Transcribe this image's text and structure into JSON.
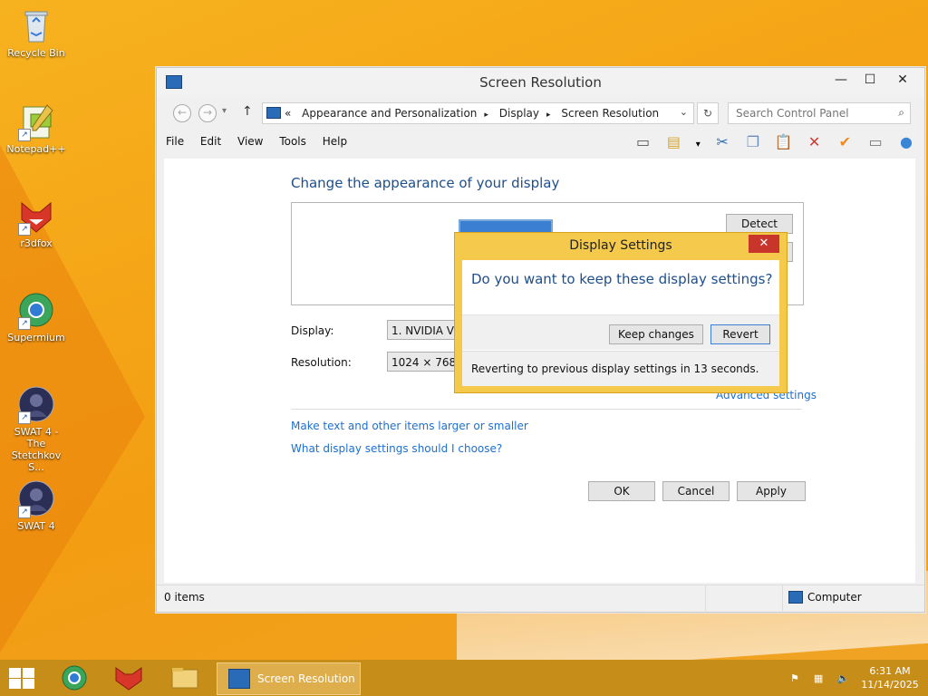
{
  "desktop": {
    "icons": [
      {
        "label": "Recycle Bin",
        "icon": "recycle-bin-icon"
      },
      {
        "label": "Notepad++",
        "icon": "notepad-plus-plus-icon"
      },
      {
        "label": "r3dfox",
        "icon": "r3dfox-icon"
      },
      {
        "label": "Supermium",
        "icon": "supermium-icon"
      },
      {
        "label": "SWAT 4 - The Stetchkov S...",
        "icon": "swat4-icon"
      },
      {
        "label": "SWAT 4",
        "icon": "swat4-icon"
      }
    ]
  },
  "window": {
    "title": "Screen Resolution",
    "address": {
      "prefix": "«",
      "crumbs": [
        "Appearance and Personalization",
        "Display",
        "Screen Resolution"
      ]
    },
    "search": {
      "placeholder": "Search Control Panel"
    },
    "menu": [
      "File",
      "Edit",
      "View",
      "Tools",
      "Help"
    ],
    "content": {
      "heading": "Change the appearance of your display",
      "detect": "Detect",
      "display_label": "Display:",
      "display_value": "1. NVIDIA VGX",
      "resolution_label": "Resolution:",
      "resolution_value": "1024 × 768",
      "advanced": "Advanced settings",
      "link1": "Make text and other items larger or smaller",
      "link2": "What display settings should I choose?",
      "ok": "OK",
      "cancel": "Cancel",
      "apply": "Apply"
    },
    "status": {
      "items": "0 items",
      "location": "Computer"
    }
  },
  "dialog": {
    "title": "Display Settings",
    "question": "Do you want to keep these display settings?",
    "keep": "Keep changes",
    "revert": "Revert",
    "countdown": "Reverting to previous display settings in 13 seconds."
  },
  "taskbar": {
    "active_label": "Screen Resolution",
    "time": "6:31 AM",
    "date": "11/14/2025"
  },
  "colors": {
    "accent_link": "#1e6fcf",
    "dialog_frame": "#f4c94c",
    "close_red": "#c8352b",
    "taskbar": "#c68d18"
  }
}
